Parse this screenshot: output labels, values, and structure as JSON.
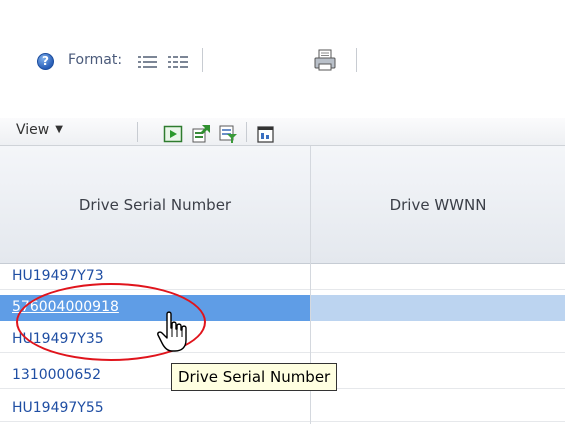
{
  "toolbar": {
    "help_glyph": "?",
    "format_label": "Format:",
    "format_icons": [
      "list-format-icon",
      "detailed-list-format-icon"
    ],
    "print_icon": "print-icon"
  },
  "view_toolbar": {
    "view_label": "View",
    "icons": [
      "run-icon",
      "export-icon",
      "filter-icon",
      "detach-icon"
    ]
  },
  "table": {
    "columns": [
      "Drive Serial Number",
      "Drive WWNN"
    ],
    "rows": [
      {
        "serial": "HU19497Y73",
        "wwnn": ""
      },
      {
        "serial": "576004000918",
        "wwnn": "",
        "selected": true
      },
      {
        "serial": "HU19497Y35",
        "wwnn": ""
      },
      {
        "serial": "1310000652",
        "wwnn": ""
      },
      {
        "serial": "HU19497Y55",
        "wwnn": ""
      }
    ]
  },
  "tooltip": {
    "text": "Drive Serial Number"
  },
  "colors": {
    "link": "#1f4ea3",
    "selected_row": "#5f9de6",
    "highlight_ellipse": "#e0141c"
  }
}
